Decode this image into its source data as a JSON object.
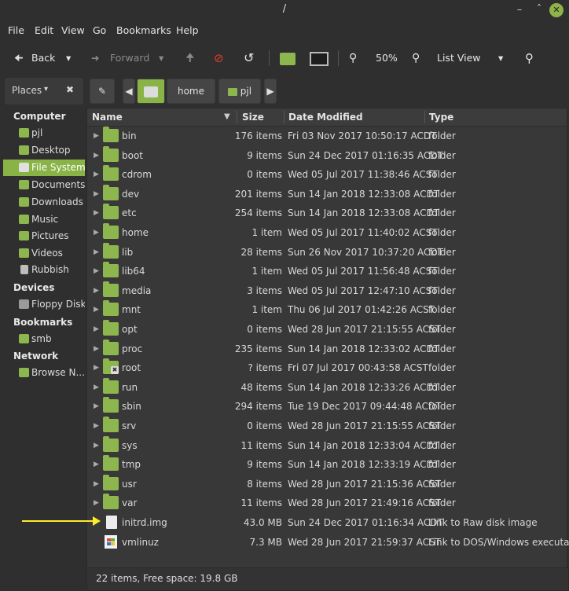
{
  "window": {
    "title": "/"
  },
  "menu": [
    "File",
    "Edit",
    "View",
    "Go",
    "Bookmarks",
    "Help"
  ],
  "toolbar": {
    "back": "Back",
    "forward": "Forward",
    "zoom": "50%",
    "view_mode": "List View"
  },
  "pathbar": {
    "places": "Places",
    "crumbs": [
      "home",
      "pjl"
    ]
  },
  "sidebar": {
    "computer_header": "Computer",
    "computer": [
      "pjl",
      "Desktop",
      "File System",
      "Documents",
      "Downloads",
      "Music",
      "Pictures",
      "Videos",
      "Rubbish"
    ],
    "devices_header": "Devices",
    "devices": [
      "Floppy Disk"
    ],
    "bookmarks_header": "Bookmarks",
    "bookmarks": [
      "smb"
    ],
    "network_header": "Network",
    "network": [
      "Browse N..."
    ]
  },
  "columns": {
    "name": "Name",
    "size": "Size",
    "date": "Date Modified",
    "type": "Type"
  },
  "rows": [
    {
      "name": "bin",
      "size": "176 items",
      "date": "Fri 03 Nov 2017 10:50:17 ACDT",
      "type": "folder",
      "kind": "folder"
    },
    {
      "name": "boot",
      "size": "9 items",
      "date": "Sun 24 Dec 2017 01:16:35 ACDT",
      "type": "folder",
      "kind": "folder"
    },
    {
      "name": "cdrom",
      "size": "0 items",
      "date": "Wed 05 Jul 2017 11:38:46 ACST",
      "type": "folder",
      "kind": "folder"
    },
    {
      "name": "dev",
      "size": "201 items",
      "date": "Sun 14 Jan 2018 12:33:08 ACDT",
      "type": "folder",
      "kind": "folder"
    },
    {
      "name": "etc",
      "size": "254 items",
      "date": "Sun 14 Jan 2018 12:33:08 ACDT",
      "type": "folder",
      "kind": "folder"
    },
    {
      "name": "home",
      "size": "1 item",
      "date": "Wed 05 Jul 2017 11:40:02 ACST",
      "type": "folder",
      "kind": "folder"
    },
    {
      "name": "lib",
      "size": "28 items",
      "date": "Sun 26 Nov 2017 10:37:20 ACDT",
      "type": "folder",
      "kind": "folder"
    },
    {
      "name": "lib64",
      "size": "1 item",
      "date": "Wed 05 Jul 2017 11:56:48 ACST",
      "type": "folder",
      "kind": "folder"
    },
    {
      "name": "media",
      "size": "3 items",
      "date": "Wed 05 Jul 2017 12:47:10 ACST",
      "type": "folder",
      "kind": "folder"
    },
    {
      "name": "mnt",
      "size": "1 item",
      "date": "Thu 06 Jul 2017 01:42:26 ACST",
      "type": "folder",
      "kind": "folder"
    },
    {
      "name": "opt",
      "size": "0 items",
      "date": "Wed 28 Jun 2017 21:15:55 ACST",
      "type": "folder",
      "kind": "folder"
    },
    {
      "name": "proc",
      "size": "235 items",
      "date": "Sun 14 Jan 2018 12:33:02 ACDT",
      "type": "folder",
      "kind": "folder"
    },
    {
      "name": "root",
      "size": "? items",
      "date": "Fri 07 Jul 2017 00:43:58 ACST",
      "type": "folder",
      "kind": "folder-locked"
    },
    {
      "name": "run",
      "size": "48 items",
      "date": "Sun 14 Jan 2018 12:33:26 ACDT",
      "type": "folder",
      "kind": "folder"
    },
    {
      "name": "sbin",
      "size": "294 items",
      "date": "Tue 19 Dec 2017 09:44:48 ACDT",
      "type": "folder",
      "kind": "folder"
    },
    {
      "name": "srv",
      "size": "0 items",
      "date": "Wed 28 Jun 2017 21:15:55 ACST",
      "type": "folder",
      "kind": "folder"
    },
    {
      "name": "sys",
      "size": "11 items",
      "date": "Sun 14 Jan 2018 12:33:04 ACDT",
      "type": "folder",
      "kind": "folder"
    },
    {
      "name": "tmp",
      "size": "9 items",
      "date": "Sun 14 Jan 2018 12:33:19 ACDT",
      "type": "folder",
      "kind": "folder"
    },
    {
      "name": "usr",
      "size": "8 items",
      "date": "Wed 28 Jun 2017 21:15:36 ACST",
      "type": "folder",
      "kind": "folder"
    },
    {
      "name": "var",
      "size": "11 items",
      "date": "Wed 28 Jun 2017 21:49:16 ACST",
      "type": "folder",
      "kind": "folder"
    },
    {
      "name": "initrd.img",
      "size": "43.0 MB",
      "date": "Sun 24 Dec 2017 01:16:34 ACDT",
      "type": "Link to Raw disk image",
      "kind": "file"
    },
    {
      "name": "vmlinuz",
      "size": "7.3 MB",
      "date": "Wed 28 Jun 2017 21:59:37 ACST",
      "type": "Link to DOS/Windows executable",
      "kind": "exe"
    }
  ],
  "status": "22 items, Free space: 19.8 GB",
  "colors": {
    "accent": "#8ab347",
    "folder": "#8db64e",
    "annotation_arrow": "#ffeb2a"
  }
}
